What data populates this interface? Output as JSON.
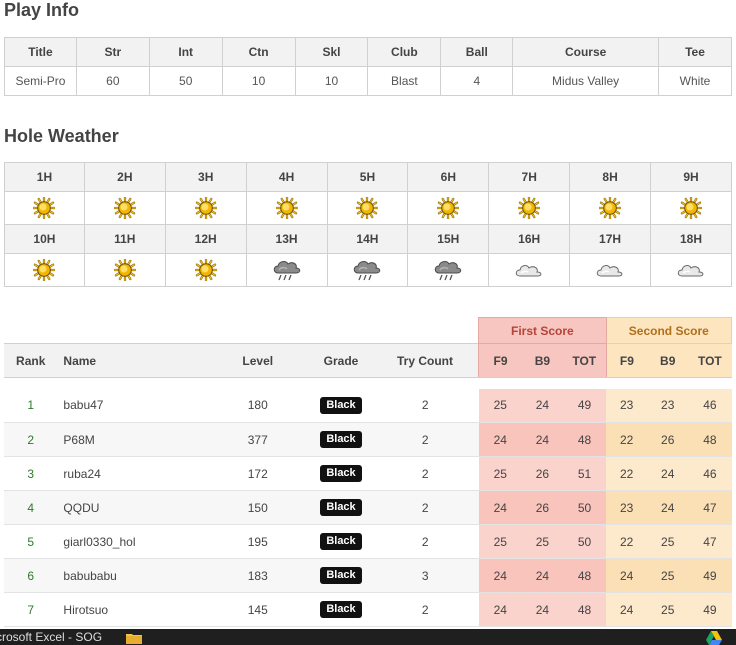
{
  "play_info": {
    "title": "Play Info",
    "headers": [
      "Title",
      "Str",
      "Int",
      "Ctn",
      "Skl",
      "Club",
      "Ball",
      "Course",
      "Tee"
    ],
    "values": [
      "Semi-Pro",
      "60",
      "50",
      "10",
      "10",
      "Blast",
      "4",
      "Midus Valley",
      "White"
    ]
  },
  "hole_weather": {
    "title": "Hole Weather",
    "front": [
      {
        "hole": "1H",
        "icon": "sun-icon"
      },
      {
        "hole": "2H",
        "icon": "sun-icon"
      },
      {
        "hole": "3H",
        "icon": "sun-icon"
      },
      {
        "hole": "4H",
        "icon": "sun-icon"
      },
      {
        "hole": "5H",
        "icon": "sun-icon"
      },
      {
        "hole": "6H",
        "icon": "sun-icon"
      },
      {
        "hole": "7H",
        "icon": "sun-icon"
      },
      {
        "hole": "8H",
        "icon": "sun-icon"
      },
      {
        "hole": "9H",
        "icon": "sun-icon"
      }
    ],
    "back": [
      {
        "hole": "10H",
        "icon": "sun-icon"
      },
      {
        "hole": "11H",
        "icon": "sun-icon"
      },
      {
        "hole": "12H",
        "icon": "sun-icon"
      },
      {
        "hole": "13H",
        "icon": "rain-cloud-icon"
      },
      {
        "hole": "14H",
        "icon": "rain-cloud-icon"
      },
      {
        "hole": "15H",
        "icon": "rain-cloud-icon"
      },
      {
        "hole": "16H",
        "icon": "cloud-icon"
      },
      {
        "hole": "17H",
        "icon": "cloud-icon"
      },
      {
        "hole": "18H",
        "icon": "cloud-icon"
      }
    ]
  },
  "scores": {
    "group_first": "First Score",
    "group_second": "Second Score",
    "headers": {
      "rank": "Rank",
      "name": "Name",
      "level": "Level",
      "grade": "Grade",
      "try_count": "Try Count",
      "f9": "F9",
      "b9": "B9",
      "tot": "TOT"
    },
    "rows": [
      {
        "rank": "1",
        "name": "babu47",
        "level": "180",
        "grade": "Black",
        "try_count": "2",
        "first": [
          "25",
          "24",
          "49"
        ],
        "second": [
          "23",
          "23",
          "46"
        ]
      },
      {
        "rank": "2",
        "name": "P68M",
        "level": "377",
        "grade": "Black",
        "try_count": "2",
        "first": [
          "24",
          "24",
          "48"
        ],
        "second": [
          "22",
          "26",
          "48"
        ]
      },
      {
        "rank": "3",
        "name": "ruba24",
        "level": "172",
        "grade": "Black",
        "try_count": "2",
        "first": [
          "25",
          "26",
          "51"
        ],
        "second": [
          "22",
          "24",
          "46"
        ]
      },
      {
        "rank": "4",
        "name": "QQDU",
        "level": "150",
        "grade": "Black",
        "try_count": "2",
        "first": [
          "24",
          "26",
          "50"
        ],
        "second": [
          "23",
          "24",
          "47"
        ]
      },
      {
        "rank": "5",
        "name": "giarl0330_hol",
        "level": "195",
        "grade": "Black",
        "try_count": "2",
        "first": [
          "25",
          "25",
          "50"
        ],
        "second": [
          "22",
          "25",
          "47"
        ]
      },
      {
        "rank": "6",
        "name": "babubabu",
        "level": "183",
        "grade": "Black",
        "try_count": "3",
        "first": [
          "24",
          "24",
          "48"
        ],
        "second": [
          "24",
          "25",
          "49"
        ]
      },
      {
        "rank": "7",
        "name": "Hirotsuo",
        "level": "145",
        "grade": "Black",
        "try_count": "2",
        "first": [
          "24",
          "24",
          "48"
        ],
        "second": [
          "24",
          "25",
          "49"
        ]
      }
    ]
  },
  "taskbar": {
    "label": "crosoft Excel - SOG"
  },
  "colors": {
    "first_score_bg": "#f7c6c0",
    "second_score_bg": "#fde5c0",
    "rank_green": "#2d7a2d"
  }
}
